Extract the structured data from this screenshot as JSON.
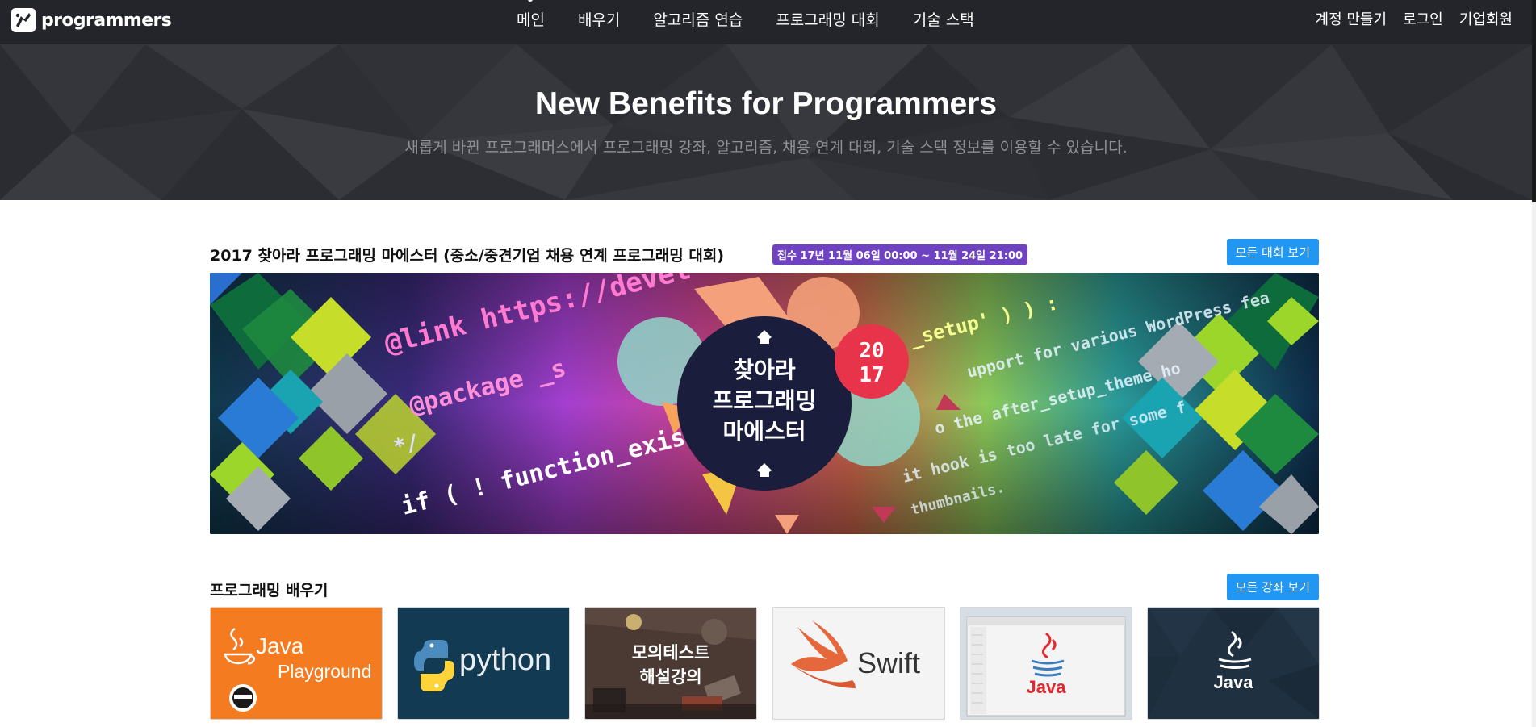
{
  "nav": {
    "logo_text": "programmers",
    "items": [
      "메인",
      "배우기",
      "알고리즘 연습",
      "프로그래밍 대회",
      "기술 스택"
    ],
    "active_index": 0,
    "right": [
      "계정 만들기",
      "로그인",
      "기업회원"
    ]
  },
  "hero": {
    "title": "New Benefits for Programmers",
    "subtitle": "새롭게 바뀐 프로그래머스에서 프로그래밍 강좌, 알고리즘, 채용 연계 대회, 기술 스택 정보를 이용할 수 있습니다."
  },
  "contest": {
    "title": "2017 찾아라 프로그래밍 마에스터 (중소/중견기업 채용 연계 프로그래밍 대회)",
    "badge": "접수 17년 11월 06일 00:00 ~ 11월 24일 21:00",
    "button": "모든 대회 보기",
    "banner": {
      "title_lines": [
        "찾아라",
        "프로그래밍",
        "마에스터"
      ],
      "year_lines": [
        "20",
        "17"
      ],
      "code_lines": [
        "@link https://devel",
        "@package _s",
        "*/",
        "if ( ! function_exis",
        "_setup' ) ) :",
        "upport for various WordPress fea",
        "o the after_setup_theme ho",
        "it hook is too late for some f",
        "thumbnails."
      ]
    }
  },
  "courses": {
    "title": "프로그래밍 배우기",
    "button": "모든 강좌 보기",
    "cards": [
      {
        "name": "java-playground",
        "lines": [
          "Java",
          "Playground"
        ]
      },
      {
        "name": "python",
        "lines": [
          "python"
        ]
      },
      {
        "name": "mock-test",
        "lines": [
          "모의테스트",
          "해설강의"
        ]
      },
      {
        "name": "swift",
        "lines": [
          "Swift"
        ]
      },
      {
        "name": "java-ide",
        "lines": [
          "Java"
        ]
      },
      {
        "name": "java-dark",
        "lines": [
          "Java"
        ]
      }
    ]
  },
  "colors": {
    "nav_bg": "#23252a",
    "hero_bg": "#2e3036",
    "badge_bg": "#6f42c1",
    "button_bg": "#2196f3"
  }
}
